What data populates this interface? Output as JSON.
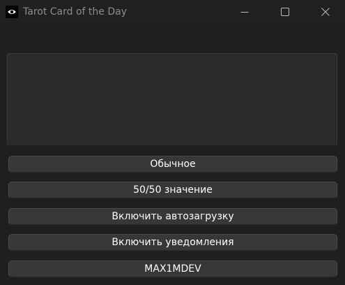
{
  "window": {
    "title": "Tarot Card of the Day",
    "icon": "eye-icon",
    "controls": [
      "minimize-icon",
      "maximize-icon",
      "close-icon"
    ]
  },
  "buttons": {
    "normal": "Обычное",
    "fifty_fifty": "50/50 значение",
    "autostart": "Включить автозагрузку",
    "notifications": "Включить уведомления",
    "author": "MAX1MDEV"
  },
  "colors": {
    "background": "#1f1f1f",
    "button": "#373737",
    "card_frame": "#2b2b2b",
    "text": "#ffffff"
  }
}
